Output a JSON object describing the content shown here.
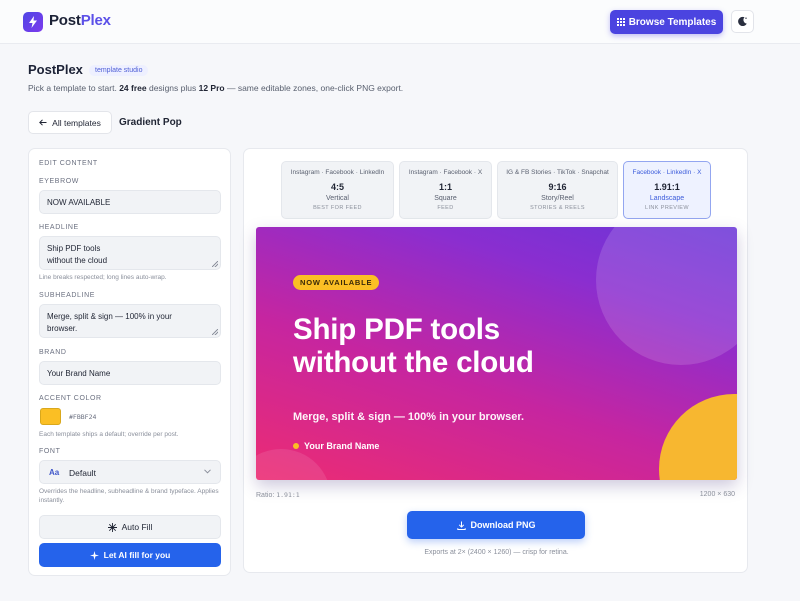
{
  "app": {
    "logo_prefix": "Post",
    "logo_suffix": "Plex"
  },
  "header": {
    "browse_label": "Browse Templates"
  },
  "intro": {
    "title": "PostPlex",
    "badge": "template studio",
    "line_pre": "Pick a template to start. ",
    "free_count": "24 free",
    "line_mid": " designs plus ",
    "pro_count": "12 Pro",
    "line_post": " — same editable zones, one-click PNG export."
  },
  "nav": {
    "all_templates_label": "All templates",
    "current_template": "Gradient Pop"
  },
  "editor": {
    "section_label": "EDIT CONTENT",
    "eyebrow_label": "EYEBROW",
    "eyebrow_value": "NOW AVAILABLE",
    "headline_label": "HEADLINE",
    "headline_line1": "Ship PDF tools",
    "headline_line2": "without the cloud",
    "headline_hint": "Line breaks respected; long lines auto-wrap.",
    "subheadline_label": "SUBHEADLINE",
    "subheadline_line1": "Merge, split & sign — 100% in your",
    "subheadline_line2": "browser.",
    "brand_label": "BRAND",
    "brand_placeholder": "Your Brand Name",
    "accent_label": "ACCENT COLOR",
    "accent_hex": "#FBBF24",
    "accent_color": "#fbbf24",
    "accent_hint": "Each template ships a default; override per post.",
    "font_label": "FONT",
    "font_glyph": "Aa",
    "font_value": "Default",
    "font_hint": "Overrides the headline, subheadline & brand typeface. Applies instantly.",
    "autofill_label": "Auto Fill",
    "aifill_label": "Let AI fill for you"
  },
  "ratios": [
    {
      "platforms": "Instagram · Facebook · LinkedIn",
      "ratio": "4:5",
      "orientation": "Vertical",
      "use": "BEST FOR FEED",
      "active": false
    },
    {
      "platforms": "Instagram · Facebook · X",
      "ratio": "1:1",
      "orientation": "Square",
      "use": "FEED",
      "active": false
    },
    {
      "platforms": "IG & FB Stories · TikTok · Snapchat",
      "ratio": "9:16",
      "orientation": "Story/Reel",
      "use": "STORIES & REELS",
      "active": false
    },
    {
      "platforms": "Facebook · LinkedIn · X",
      "ratio": "1.91:1",
      "orientation": "Landscape",
      "use": "LINK PREVIEW",
      "active": true
    }
  ],
  "preview": {
    "eyebrow": "NOW AVAILABLE",
    "headline_line1": "Ship PDF tools",
    "headline_line2": "without the cloud",
    "subheadline": "Merge, split & sign — 100% in your browser.",
    "brand": "Your Brand Name",
    "ratio_prefix": "Ratio: ",
    "ratio_value": "1.91:1",
    "dimensions": "1200 × 630",
    "download_label": "Download PNG",
    "export_note": "Exports at 2× (2400 × 1260) — crisp for retina."
  },
  "colors": {
    "brand": "#4b44e0",
    "primary_button": "#2563eb",
    "accent": "#fbbf24"
  }
}
